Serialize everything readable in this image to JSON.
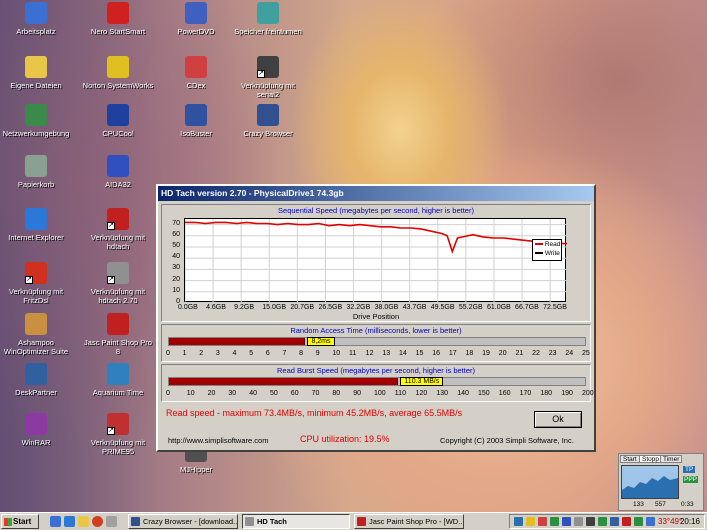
{
  "desktop_icons": [
    {
      "label": "Arbeitsplatz",
      "icon": "my-computer-icon",
      "color": "#3c6fd2"
    },
    {
      "label": "Eigene Dateien",
      "icon": "folder-icon",
      "color": "#e8c648"
    },
    {
      "label": "Netzwerkumgebung",
      "icon": "network-icon",
      "color": "#3c8a4a"
    },
    {
      "label": "Papierkorb",
      "icon": "recycle-bin-icon",
      "color": "#8aa090"
    },
    {
      "label": "Internet Explorer",
      "icon": "ie-icon",
      "color": "#2c78d8"
    },
    {
      "label": "Verknüpfung mit FritzDsl",
      "icon": "fritzdsl-icon",
      "color": "#d03020"
    },
    {
      "label": "Ashampoo WinOptimizer Suite",
      "icon": "ashampoo-icon",
      "color": "#c89040"
    },
    {
      "label": "DeskPartner",
      "icon": "deskpartner-icon",
      "color": "#3060a0"
    },
    {
      "label": "WinRAR",
      "icon": "winrar-icon",
      "color": "#8a3aa0"
    },
    {
      "label": "Nero StartSmart",
      "icon": "nero-icon",
      "color": "#d02020"
    },
    {
      "label": "Norton SystemWorks",
      "icon": "norton-icon",
      "color": "#e0c020"
    },
    {
      "label": "CPUCool",
      "icon": "cpucool-icon",
      "color": "#2040a0"
    },
    {
      "label": "AIDA32",
      "icon": "aida32-icon",
      "color": "#3050c0"
    },
    {
      "label": "Verknüpfung mit hdtach",
      "icon": "cdro-icon",
      "color": "#c02020"
    },
    {
      "label": "Verknüpfung mit hdtach 2.70",
      "icon": "hdtach-icon",
      "color": "#909090"
    },
    {
      "label": "Jasc Paint Shop Pro 8",
      "icon": "paintshop-icon",
      "color": "#c02020"
    },
    {
      "label": "Aquarium Time",
      "icon": "aquarium-icon",
      "color": "#3080c0"
    },
    {
      "label": "Verknüpfung mit PRIME95",
      "icon": "prime95-icon",
      "color": "#c03030"
    },
    {
      "label": "PowerDVD",
      "icon": "powerdvd-icon",
      "color": "#4060c0"
    },
    {
      "label": "CDex",
      "icon": "cdex-icon",
      "color": "#d04040"
    },
    {
      "label": "IsoBuster",
      "icon": "isobuster-icon",
      "color": "#3050a0"
    },
    {
      "label": "Speicher freiräumen",
      "icon": "speicher-icon",
      "color": "#40a0a0"
    },
    {
      "label": "Verknüpfung mit serial2",
      "icon": "serial-icon",
      "color": "#404040"
    },
    {
      "label": "Crazy Browser",
      "icon": "crazy-browser-icon",
      "color": "#305090"
    },
    {
      "label": "MJHipper",
      "icon": "mjhipper-icon",
      "color": "#505050"
    }
  ],
  "window": {
    "title": "HD Tach version 2.70 - PhysicalDrive1 74.3gb",
    "sequential_title": "Sequential Speed (megabytes per second, higher is better)",
    "random_title": "Random Access Time (milliseconds, lower is better)",
    "burst_title": "Read Burst Speed (megabytes per second, higher is better)",
    "legend_read": "Read",
    "legend_write": "Write",
    "xlabel": "Drive Position",
    "random_value_label": "8,2ms",
    "random_value": 8.2,
    "random_scale": [
      "0",
      "1",
      "2",
      "3",
      "4",
      "5",
      "6",
      "7",
      "8",
      "9",
      "10",
      "11",
      "12",
      "13",
      "14",
      "15",
      "16",
      "17",
      "18",
      "19",
      "20",
      "21",
      "22",
      "23",
      "24",
      "25"
    ],
    "burst_value_label": "110.3 MB/s",
    "burst_value": 110.3,
    "burst_scale": [
      "0",
      "10",
      "20",
      "30",
      "40",
      "50",
      "60",
      "70",
      "80",
      "90",
      "100",
      "110",
      "120",
      "130",
      "140",
      "150",
      "160",
      "170",
      "180",
      "190",
      "200"
    ],
    "read_speed": "Read speed - maximum 73.4MB/s, minimum 45.2MB/s, average 65.5MB/s",
    "ok_label": "Ok",
    "url": "http://www.simplisoftware.com",
    "cpu": "CPU utilization: 19.5%",
    "copyright": "Copyright (C) 2003 Simpli Software, Inc."
  },
  "chart_data": {
    "type": "line",
    "title": "Sequential Speed (megabytes per second, higher is better)",
    "xlabel": "Drive Position",
    "ylabel": "",
    "ylim": [
      0,
      75
    ],
    "yticks": [
      "0",
      "10",
      "20",
      "30",
      "40",
      "50",
      "60",
      "70"
    ],
    "xticks": [
      "0.0GB",
      "4.6GB",
      "9.2GB",
      "15.0GB",
      "20.7GB",
      "26.5GB",
      "32.2GB",
      "38.0GB",
      "43.7GB",
      "49.5GB",
      "55.2GB",
      "61.0GB",
      "66.7GB",
      "72.5GB"
    ],
    "grid": true,
    "legend": "right",
    "series": [
      {
        "name": "Read",
        "color": "#e00000",
        "x": [
          0,
          2,
          4,
          6,
          8,
          10,
          12,
          14,
          16,
          18,
          20,
          22,
          24,
          26,
          28,
          30,
          32,
          34,
          36,
          38,
          40,
          42,
          44,
          46,
          48,
          50,
          51,
          52,
          53,
          54,
          56,
          58,
          60,
          62,
          64,
          66,
          68,
          70,
          72,
          74.3
        ],
        "values": [
          72,
          72,
          71,
          72,
          72,
          71,
          72,
          71,
          71,
          70,
          71,
          70,
          70,
          71,
          69,
          70,
          69,
          70,
          69,
          68,
          68,
          67,
          67,
          66,
          64,
          62,
          60,
          46,
          58,
          59,
          61,
          59,
          58,
          58,
          57,
          56,
          55,
          56,
          53,
          53
        ]
      },
      {
        "name": "Write",
        "color": "#ffffff",
        "x": [],
        "values": []
      }
    ]
  },
  "taskbar": {
    "start": "Start",
    "tasks": [
      {
        "label": "Crazy Browser - [download...",
        "icon": "crazy-browser-icon",
        "color": "#305090",
        "active": false
      },
      {
        "label": "HD Tach",
        "icon": "hdtach-icon",
        "color": "#909090",
        "active": true
      },
      {
        "label": "Jasc Paint Shop Pro - [WD...",
        "icon": "paintshop-icon",
        "color": "#c02020",
        "active": false
      }
    ],
    "temperature": "33°49°",
    "clock": "20:16"
  },
  "gadget": {
    "tabs": [
      "Start",
      "Stopp",
      "Timer"
    ],
    "values": [
      "TP",
      "PPP",
      "133",
      "557",
      "0:33"
    ]
  }
}
